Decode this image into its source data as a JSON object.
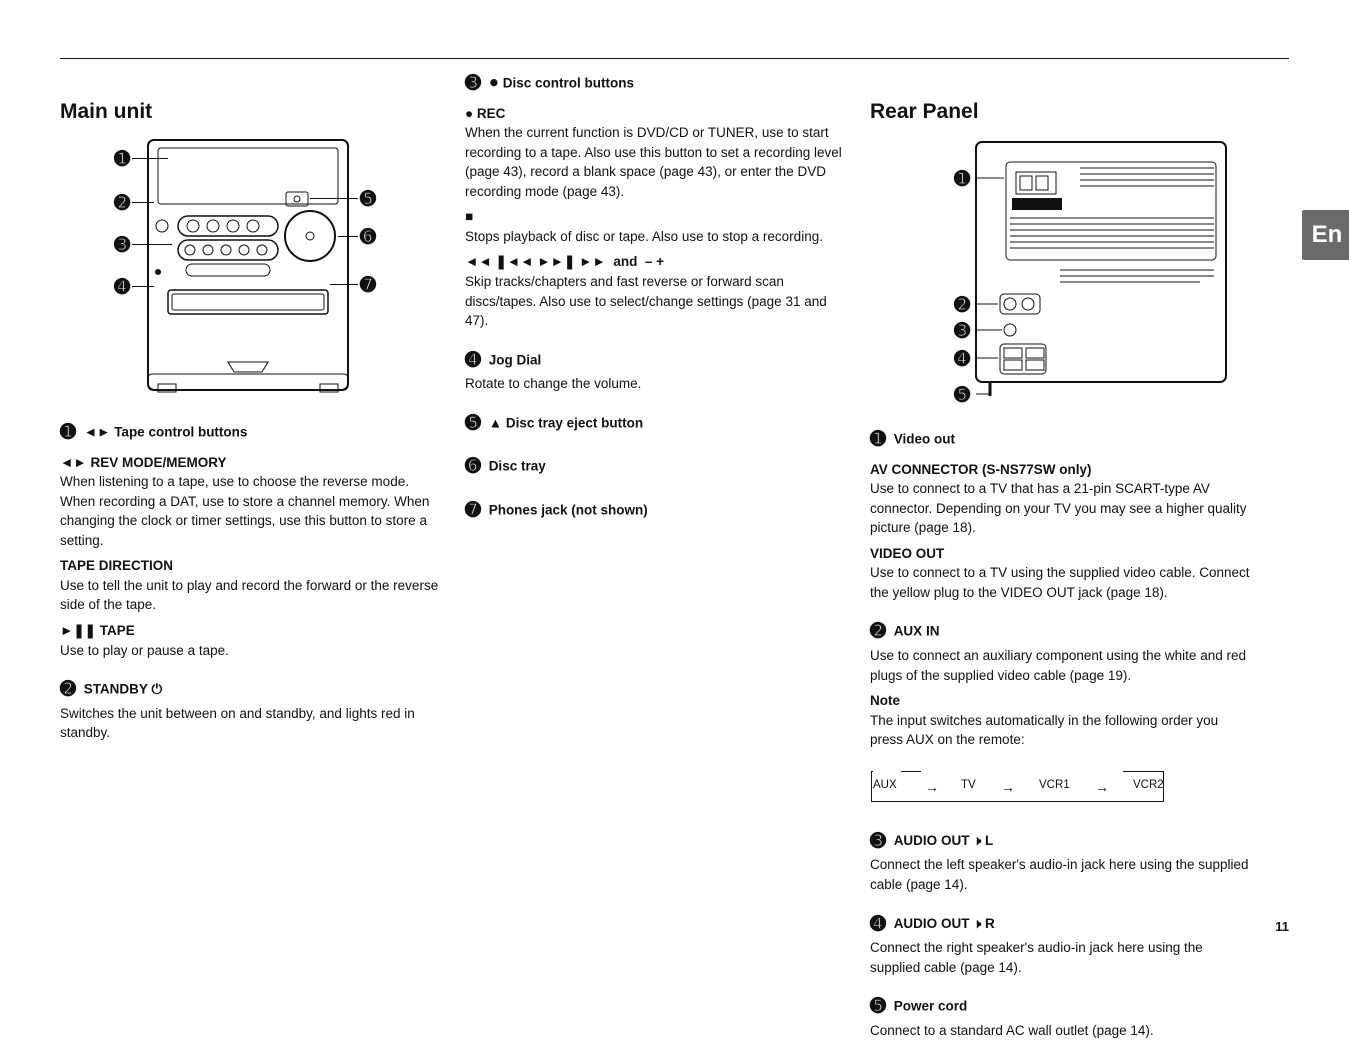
{
  "page_number": "11",
  "lang_tab": "En",
  "col1": {
    "heading": "Main unit",
    "items": [
      {
        "title": "Tape control buttons",
        "sub1_label": "◄► REV MODE/MEMORY",
        "sub1_text": "When listening to a tape, use to choose the reverse mode. When recording a DAT, use to store a channel memory. When changing the clock or timer settings, use this button to store a setting.",
        "sub2_label": "TAPE DIRECTION",
        "sub2_text": "Use to tell the unit to play and record the forward or the reverse side of the tape.",
        "sub3_label": "►❚❚ TAPE",
        "sub3_text": "Use to play or pause a tape."
      },
      {
        "title": "STANDBY",
        "symbol": "(power)",
        "text": "Switches the unit between on and standby, and lights red in standby."
      }
    ]
  },
  "col2": {
    "items": [
      {
        "title": "Disc control buttons",
        "sub1_label": "● REC",
        "sub1_text": "When the current function is DVD/CD or TUNER, use to start recording to a tape. Also use this button to set a recording level (page 43), record a blank space (page 43), or enter the DVD recording mode (page 43).",
        "sub2_label": "■",
        "sub2_text": "Stops playback of disc or tape. Also use to stop a recording.",
        "sub3_label": "◄◄ ❚◄◄ ►►❚ ►► and – +",
        "sub3_text": "Skip tracks/chapters and fast reverse or forward scan discs/tapes. Also use to select/change settings (page 31 and 47)."
      },
      {
        "title": "Jog Dial",
        "text": "Rotate to change the volume."
      },
      {
        "title": "Disc tray eject button",
        "symbol": "▲"
      },
      {
        "title": "Disc tray",
        "text": ""
      },
      {
        "title": "Phones jack (not shown)",
        "text": ""
      }
    ]
  },
  "col3": {
    "heading": "Rear Panel",
    "items": [
      {
        "title": "Video out",
        "sub1_label": "AV CONNECTOR (S-NS77SW only)",
        "sub1_text": "Use to connect to a TV that has a 21-pin SCART-type AV connector. Depending on your TV you may see a higher quality picture (page 18).",
        "sub2_label": "VIDEO OUT",
        "sub2_text": "Use to connect to a TV using the supplied video cable. Connect the yellow plug to the VIDEO OUT jack (page 18)."
      },
      {
        "title": "AUX IN",
        "text": "Use to connect an auxiliary component using the white and red plugs of the supplied video cable (page 19).",
        "note_label": "Note",
        "note_text": "The input switches automatically in the following order you press AUX on the remote:",
        "flow": [
          "AUX",
          "TV",
          "VCR1",
          "VCR2"
        ]
      },
      {
        "title": "AUDIO OUT (speaker-icon) L",
        "text": "Connect the left speaker's audio-in jack here using the supplied cable (page 14)."
      },
      {
        "title": "AUDIO OUT (speaker-icon) R",
        "text": "Connect the right speaker's audio-in jack here using the supplied cable (page 14)."
      },
      {
        "title": "Power cord",
        "text": "Connect to a standard AC wall outlet (page 14)."
      }
    ]
  }
}
